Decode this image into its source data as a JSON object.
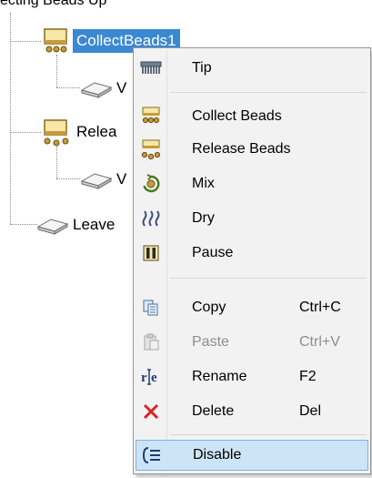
{
  "top_partial_text": "ecting Beads Up",
  "tree": {
    "nodes": [
      {
        "label": "CollectBeads1",
        "icon": "collect-beads-icon",
        "selected": true
      },
      {
        "label": "V",
        "icon": "plate-icon"
      },
      {
        "label": "Relea",
        "icon": "release-beads-icon"
      },
      {
        "label": "V",
        "icon": "plate-icon"
      },
      {
        "label": "Leave",
        "icon": "plate-icon"
      }
    ]
  },
  "context_menu": {
    "items": [
      {
        "label": "Tip",
        "shortcut": "",
        "icon": "tip-comb-icon",
        "enabled": true
      },
      {
        "label": "Collect Beads",
        "shortcut": "",
        "icon": "collect-beads-icon",
        "enabled": true
      },
      {
        "label": "Release Beads",
        "shortcut": "",
        "icon": "release-beads-icon",
        "enabled": true
      },
      {
        "label": "Mix",
        "shortcut": "",
        "icon": "mix-icon",
        "enabled": true
      },
      {
        "label": "Dry",
        "shortcut": "",
        "icon": "dry-icon",
        "enabled": true
      },
      {
        "label": "Pause",
        "shortcut": "",
        "icon": "pause-icon",
        "enabled": true
      },
      {
        "label": "Copy",
        "shortcut": "Ctrl+C",
        "icon": "copy-icon",
        "enabled": true
      },
      {
        "label": "Paste",
        "shortcut": "Ctrl+V",
        "icon": "paste-icon",
        "enabled": false
      },
      {
        "label": "Rename",
        "shortcut": "F2",
        "icon": "rename-icon",
        "enabled": true
      },
      {
        "label": "Delete",
        "shortcut": "Del",
        "icon": "delete-icon",
        "enabled": true
      },
      {
        "label": "Disable",
        "shortcut": "",
        "icon": "disable-icon",
        "enabled": true,
        "highlighted": true
      }
    ]
  },
  "colors": {
    "selection": "#3b88d2",
    "menu_bg": "#f2f2f2",
    "hover_bg": "#cde4f7",
    "delete_red": "#e02020",
    "bead_gold": "#c89a3a"
  }
}
